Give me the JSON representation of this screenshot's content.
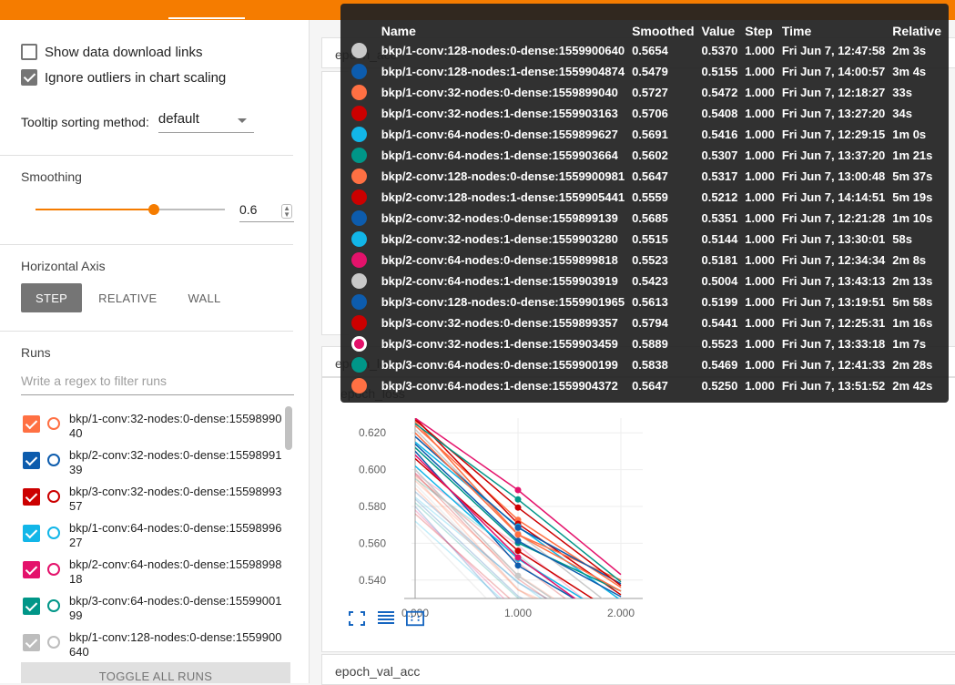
{
  "sidebar": {
    "show_download_label": "Show data download links",
    "ignore_outliers_label": "Ignore outliers in chart scaling",
    "show_download_checked": false,
    "ignore_outliers_checked": true,
    "tooltip_sort_label": "Tooltip sorting method:",
    "tooltip_sort_value": "default",
    "smoothing_title": "Smoothing",
    "smoothing_value": "0.6",
    "smoothing_fraction": 0.6,
    "horizontal_axis_title": "Horizontal Axis",
    "axis_buttons": [
      "STEP",
      "RELATIVE",
      "WALL"
    ],
    "axis_active": "STEP",
    "runs_title": "Runs",
    "runs_filter_placeholder": "Write a regex to filter runs",
    "runs": [
      {
        "name": "bkp/1-conv:32-nodes:0-dense:1559899040",
        "color": "#ff7043",
        "checked": true
      },
      {
        "name": "bkp/2-conv:32-nodes:0-dense:1559899139",
        "color": "#0d5cad",
        "checked": true
      },
      {
        "name": "bkp/3-conv:32-nodes:0-dense:1559899357",
        "color": "#cc0000",
        "checked": true
      },
      {
        "name": "bkp/1-conv:64-nodes:0-dense:1559899627",
        "color": "#12b6e8",
        "checked": true
      },
      {
        "name": "bkp/2-conv:64-nodes:0-dense:1559899818",
        "color": "#e4126b",
        "checked": true
      },
      {
        "name": "bkp/3-conv:64-nodes:0-dense:1559900199",
        "color": "#009688",
        "checked": true
      },
      {
        "name": "bkp/1-conv:128-nodes:0-dense:1559900640",
        "color": "#bdbdbd",
        "checked": true
      }
    ],
    "toggle_all_label": "TOGGLE ALL RUNS"
  },
  "main": {
    "card_epoch_acc_title": "epoch_acc",
    "card_epoch_loss_header": "epoch_loss",
    "chart_title": "epoch_loss",
    "card_val_acc_title": "epoch_val_acc"
  },
  "tooltip": {
    "headers": [
      "Name",
      "Smoothed",
      "Value",
      "Step",
      "Time",
      "Relative"
    ],
    "rows": [
      {
        "color": "#c9c9c9",
        "ring": false,
        "name": "bkp/1-conv:128-nodes:0-dense:1559900640",
        "smoothed": "0.5654",
        "value": "0.5370",
        "step": "1.000",
        "time": "Fri Jun 7, 12:47:58",
        "relative": "2m 3s"
      },
      {
        "color": "#0d5cad",
        "ring": false,
        "name": "bkp/1-conv:128-nodes:1-dense:1559904874",
        "smoothed": "0.5479",
        "value": "0.5155",
        "step": "1.000",
        "time": "Fri Jun 7, 14:00:57",
        "relative": "3m 4s"
      },
      {
        "color": "#ff7043",
        "ring": false,
        "name": "bkp/1-conv:32-nodes:0-dense:1559899040",
        "smoothed": "0.5727",
        "value": "0.5472",
        "step": "1.000",
        "time": "Fri Jun 7, 12:18:27",
        "relative": "33s"
      },
      {
        "color": "#cc0000",
        "ring": false,
        "name": "bkp/1-conv:32-nodes:1-dense:1559903163",
        "smoothed": "0.5706",
        "value": "0.5408",
        "step": "1.000",
        "time": "Fri Jun 7, 13:27:20",
        "relative": "34s"
      },
      {
        "color": "#12b6e8",
        "ring": false,
        "name": "bkp/1-conv:64-nodes:0-dense:1559899627",
        "smoothed": "0.5691",
        "value": "0.5416",
        "step": "1.000",
        "time": "Fri Jun 7, 12:29:15",
        "relative": "1m 0s"
      },
      {
        "color": "#009688",
        "ring": false,
        "name": "bkp/1-conv:64-nodes:1-dense:1559903664",
        "smoothed": "0.5602",
        "value": "0.5307",
        "step": "1.000",
        "time": "Fri Jun 7, 13:37:20",
        "relative": "1m 21s"
      },
      {
        "color": "#ff7043",
        "ring": false,
        "name": "bkp/2-conv:128-nodes:0-dense:1559900981",
        "smoothed": "0.5647",
        "value": "0.5317",
        "step": "1.000",
        "time": "Fri Jun 7, 13:00:48",
        "relative": "5m 37s"
      },
      {
        "color": "#cc0000",
        "ring": false,
        "name": "bkp/2-conv:128-nodes:1-dense:1559905441",
        "smoothed": "0.5559",
        "value": "0.5212",
        "step": "1.000",
        "time": "Fri Jun 7, 14:14:51",
        "relative": "5m 19s"
      },
      {
        "color": "#0d5cad",
        "ring": false,
        "name": "bkp/2-conv:32-nodes:0-dense:1559899139",
        "smoothed": "0.5685",
        "value": "0.5351",
        "step": "1.000",
        "time": "Fri Jun 7, 12:21:28",
        "relative": "1m 10s"
      },
      {
        "color": "#12b6e8",
        "ring": false,
        "name": "bkp/2-conv:32-nodes:1-dense:1559903280",
        "smoothed": "0.5515",
        "value": "0.5144",
        "step": "1.000",
        "time": "Fri Jun 7, 13:30:01",
        "relative": "58s"
      },
      {
        "color": "#e4126b",
        "ring": false,
        "name": "bkp/2-conv:64-nodes:0-dense:1559899818",
        "smoothed": "0.5523",
        "value": "0.5181",
        "step": "1.000",
        "time": "Fri Jun 7, 12:34:34",
        "relative": "2m 8s"
      },
      {
        "color": "#c9c9c9",
        "ring": false,
        "name": "bkp/2-conv:64-nodes:1-dense:1559903919",
        "smoothed": "0.5423",
        "value": "0.5004",
        "step": "1.000",
        "time": "Fri Jun 7, 13:43:13",
        "relative": "2m 13s"
      },
      {
        "color": "#0d5cad",
        "ring": false,
        "name": "bkp/3-conv:128-nodes:0-dense:1559901965",
        "smoothed": "0.5613",
        "value": "0.5199",
        "step": "1.000",
        "time": "Fri Jun 7, 13:19:51",
        "relative": "5m 58s"
      },
      {
        "color": "#cc0000",
        "ring": false,
        "name": "bkp/3-conv:32-nodes:0-dense:1559899357",
        "smoothed": "0.5794",
        "value": "0.5441",
        "step": "1.000",
        "time": "Fri Jun 7, 12:25:31",
        "relative": "1m 16s"
      },
      {
        "color": "#e4126b",
        "ring": true,
        "name": "bkp/3-conv:32-nodes:1-dense:1559903459",
        "smoothed": "0.5889",
        "value": "0.5523",
        "step": "1.000",
        "time": "Fri Jun 7, 13:33:18",
        "relative": "1m 7s"
      },
      {
        "color": "#009688",
        "ring": false,
        "name": "bkp/3-conv:64-nodes:0-dense:1559900199",
        "smoothed": "0.5838",
        "value": "0.5469",
        "step": "1.000",
        "time": "Fri Jun 7, 12:41:33",
        "relative": "2m 28s"
      },
      {
        "color": "#ff7043",
        "ring": false,
        "name": "bkp/3-conv:64-nodes:1-dense:1559904372",
        "smoothed": "0.5647",
        "value": "0.5250",
        "step": "1.000",
        "time": "Fri Jun 7, 13:51:52",
        "relative": "2m 42s"
      }
    ]
  },
  "chart_data": {
    "type": "line",
    "title": "epoch_loss",
    "xlabel": "",
    "ylabel": "",
    "xlim": [
      0,
      2
    ],
    "ylim": [
      0.53,
      0.628
    ],
    "x_ticks": [
      "0.000",
      "1.000",
      "2.000"
    ],
    "y_ticks": [
      "0.620",
      "0.600",
      "0.580",
      "0.560",
      "0.540"
    ],
    "x": [
      0,
      1,
      2
    ],
    "series": [
      {
        "color": "#c9c9c9",
        "values": [
          0.622,
          0.5654,
          0.522
        ]
      },
      {
        "color": "#0d5cad",
        "values": [
          0.61,
          0.5479,
          0.515
        ]
      },
      {
        "color": "#ff7043",
        "values": [
          0.624,
          0.5727,
          0.536
        ]
      },
      {
        "color": "#cc0000",
        "values": [
          0.628,
          0.5706,
          0.532
        ]
      },
      {
        "color": "#12b6e8",
        "values": [
          0.615,
          0.5691,
          0.529
        ]
      },
      {
        "color": "#009688",
        "values": [
          0.612,
          0.5602,
          0.534
        ]
      },
      {
        "color": "#ff7043",
        "values": [
          0.626,
          0.5647,
          0.54
        ]
      },
      {
        "color": "#cc0000",
        "values": [
          0.606,
          0.5559,
          0.52
        ]
      },
      {
        "color": "#0d5cad",
        "values": [
          0.618,
          0.5685,
          0.538
        ]
      },
      {
        "color": "#12b6e8",
        "values": [
          0.602,
          0.5515,
          0.517
        ]
      },
      {
        "color": "#e4126b",
        "values": [
          0.608,
          0.5523,
          0.512
        ]
      },
      {
        "color": "#c9c9c9",
        "values": [
          0.6,
          0.5423,
          0.505
        ]
      },
      {
        "color": "#0d5cad",
        "values": [
          0.614,
          0.5613,
          0.531
        ]
      },
      {
        "color": "#cc0000",
        "values": [
          0.627,
          0.5794,
          0.537
        ]
      },
      {
        "color": "#e4126b",
        "values": [
          0.628,
          0.5889,
          0.543
        ]
      },
      {
        "color": "#009688",
        "values": [
          0.625,
          0.5838,
          0.539
        ]
      },
      {
        "color": "#ff7043",
        "values": [
          0.62,
          0.5647,
          0.534
        ]
      }
    ]
  },
  "icons": [
    "fullscreen-icon",
    "list-icon",
    "fit-domain-icon"
  ]
}
